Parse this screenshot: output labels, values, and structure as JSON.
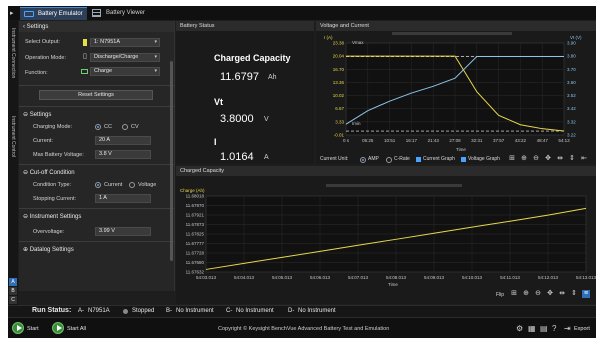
{
  "tabs": [
    {
      "label": "Battery Emulator",
      "active": true
    },
    {
      "label": "Battery Viewer",
      "active": false
    }
  ],
  "vertical_tabs": [
    "Instrument Connection",
    "Instrument Control"
  ],
  "instrument_badges": [
    "A",
    "B",
    "C",
    "D"
  ],
  "settings": {
    "header": "Settings",
    "select_output_label": "Select Output:",
    "select_output_value": "1: N7951A",
    "operation_mode_label": "Operation Mode:",
    "operation_mode_value": "Discharge/Charge",
    "function_label": "Function:",
    "function_value": "Charge",
    "reset_button": "Reset Settings",
    "sub_settings_header": "Settings",
    "charging_mode_label": "Charging Mode:",
    "charging_mode_options": [
      "CC",
      "CV"
    ],
    "charging_mode_selected": "CC",
    "current_label": "Current:",
    "current_value": "20 A",
    "max_voltage_label": "Max Battery Voltage:",
    "max_voltage_value": "3.8 V",
    "cutoff_header": "Cut-off Condition",
    "condition_type_label": "Condition Type:",
    "condition_type_options": [
      "Current",
      "Voltage"
    ],
    "condition_type_selected": "Current",
    "stopping_current_label": "Stopping Current:",
    "stopping_current_value": "1 A",
    "instrument_settings_header": "Instrument Settings",
    "overvoltage_label": "Overvoltage:",
    "overvoltage_value": "3.99 V",
    "datalog_header": "Datalog Settings"
  },
  "battery_status": {
    "header": "Battery Status",
    "charged_capacity_label": "Charged Capacity",
    "charged_capacity_value": "11.6797",
    "charged_capacity_unit": "Ah",
    "vt_label": "Vt",
    "vt_value": "3.8000",
    "vt_unit": "V",
    "i_label": "I",
    "i_value": "1.0164",
    "i_unit": "A"
  },
  "voltage_current": {
    "header": "Voltage and Current",
    "left_axis_label": "I (A)",
    "right_axis_label": "Vt (V)",
    "x_axis_label": "Time",
    "vmax_marker": "Vmax",
    "imin_marker": "Imin",
    "current_unit_label": "Current Unit:",
    "unit_options": [
      "AMP",
      "C-Rate"
    ],
    "unit_selected": "AMP",
    "legend": [
      "Current Graph",
      "Voltage Graph"
    ],
    "colors": {
      "current": "#e8d84a",
      "voltage": "#8ec5e8"
    }
  },
  "charged_capacity_panel": {
    "header": "Charged Capacity",
    "y_axis_label": "Charge (Ah)",
    "x_axis_label": "Time",
    "flip_label": "Flip"
  },
  "chart_data": [
    {
      "type": "line",
      "title": "Voltage and Current",
      "xlabel": "Time",
      "x": [
        "0 s",
        "05:25",
        "10:51",
        "16:17",
        "21:43",
        "27:08",
        "32:31",
        "37:57",
        "43:22",
        "48:47",
        "54:13"
      ],
      "y_left_label": "I (A)",
      "y_left_ticks": [
        23.38,
        20.04,
        16.7,
        13.36,
        10.02,
        6.67,
        3.33,
        -0.006
      ],
      "y_right_label": "Vt (V)",
      "y_right_ticks": [
        3.9,
        3.8,
        3.7,
        3.6,
        3.52,
        3.42,
        3.32,
        3.22
      ],
      "series": [
        {
          "name": "Current Graph",
          "axis": "left",
          "values": [
            20.04,
            20.04,
            20.04,
            20.04,
            20.04,
            20.04,
            11.0,
            5.0,
            2.6,
            1.6,
            1.0
          ]
        },
        {
          "name": "Voltage Graph",
          "axis": "right",
          "values": [
            3.3,
            3.4,
            3.47,
            3.53,
            3.58,
            3.64,
            3.8,
            3.8,
            3.8,
            3.8,
            3.8
          ]
        }
      ]
    },
    {
      "type": "line",
      "title": "Charged Capacity",
      "ylabel": "Charge (Ah)",
      "xlabel": "Time",
      "x": [
        "54:03.013",
        "54:04.013",
        "54:05.013",
        "54:06.013",
        "54:07.013",
        "54:08.013",
        "54:09.013",
        "54:10.013",
        "54:11.013",
        "54:12.013",
        "54:13.013"
      ],
      "y_ticks": [
        11.68018,
        11.6797,
        11.67921,
        11.67873,
        11.67825,
        11.67777,
        11.67728,
        11.6768,
        11.67632
      ],
      "series": [
        {
          "name": "Charge (Ah)",
          "values": [
            11.67645,
            11.67676,
            11.67706,
            11.67737,
            11.67768,
            11.67798,
            11.67829,
            11.6786,
            11.6789,
            11.67921,
            11.67955
          ]
        }
      ]
    }
  ],
  "run_status": {
    "label": "Run Status:",
    "slots": [
      {
        "id": "A-",
        "instrument": "N7951A",
        "state": "Stopped"
      },
      {
        "id": "B-",
        "instrument": "No Instrument"
      },
      {
        "id": "C-",
        "instrument": "No Instrument"
      },
      {
        "id": "D-",
        "instrument": "No Instrument"
      }
    ]
  },
  "footer": {
    "start_label": "Start",
    "start_all_label": "Start All",
    "copyright": "Copyright © Keysight BenchVue Advanced Battery Test and Emulation",
    "export_label": "Export"
  }
}
